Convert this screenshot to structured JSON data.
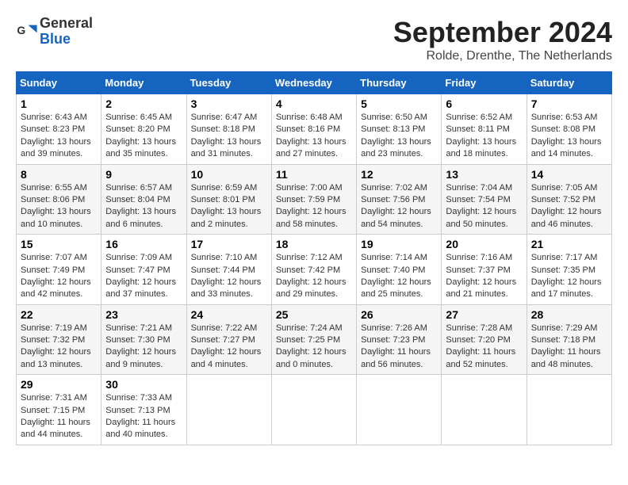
{
  "header": {
    "logo_line1": "General",
    "logo_line2": "Blue",
    "month": "September 2024",
    "location": "Rolde, Drenthe, The Netherlands"
  },
  "weekdays": [
    "Sunday",
    "Monday",
    "Tuesday",
    "Wednesday",
    "Thursday",
    "Friday",
    "Saturday"
  ],
  "weeks": [
    [
      {
        "day": "1",
        "info": "Sunrise: 6:43 AM\nSunset: 8:23 PM\nDaylight: 13 hours\nand 39 minutes."
      },
      {
        "day": "2",
        "info": "Sunrise: 6:45 AM\nSunset: 8:20 PM\nDaylight: 13 hours\nand 35 minutes."
      },
      {
        "day": "3",
        "info": "Sunrise: 6:47 AM\nSunset: 8:18 PM\nDaylight: 13 hours\nand 31 minutes."
      },
      {
        "day": "4",
        "info": "Sunrise: 6:48 AM\nSunset: 8:16 PM\nDaylight: 13 hours\nand 27 minutes."
      },
      {
        "day": "5",
        "info": "Sunrise: 6:50 AM\nSunset: 8:13 PM\nDaylight: 13 hours\nand 23 minutes."
      },
      {
        "day": "6",
        "info": "Sunrise: 6:52 AM\nSunset: 8:11 PM\nDaylight: 13 hours\nand 18 minutes."
      },
      {
        "day": "7",
        "info": "Sunrise: 6:53 AM\nSunset: 8:08 PM\nDaylight: 13 hours\nand 14 minutes."
      }
    ],
    [
      {
        "day": "8",
        "info": "Sunrise: 6:55 AM\nSunset: 8:06 PM\nDaylight: 13 hours\nand 10 minutes."
      },
      {
        "day": "9",
        "info": "Sunrise: 6:57 AM\nSunset: 8:04 PM\nDaylight: 13 hours\nand 6 minutes."
      },
      {
        "day": "10",
        "info": "Sunrise: 6:59 AM\nSunset: 8:01 PM\nDaylight: 13 hours\nand 2 minutes."
      },
      {
        "day": "11",
        "info": "Sunrise: 7:00 AM\nSunset: 7:59 PM\nDaylight: 12 hours\nand 58 minutes."
      },
      {
        "day": "12",
        "info": "Sunrise: 7:02 AM\nSunset: 7:56 PM\nDaylight: 12 hours\nand 54 minutes."
      },
      {
        "day": "13",
        "info": "Sunrise: 7:04 AM\nSunset: 7:54 PM\nDaylight: 12 hours\nand 50 minutes."
      },
      {
        "day": "14",
        "info": "Sunrise: 7:05 AM\nSunset: 7:52 PM\nDaylight: 12 hours\nand 46 minutes."
      }
    ],
    [
      {
        "day": "15",
        "info": "Sunrise: 7:07 AM\nSunset: 7:49 PM\nDaylight: 12 hours\nand 42 minutes."
      },
      {
        "day": "16",
        "info": "Sunrise: 7:09 AM\nSunset: 7:47 PM\nDaylight: 12 hours\nand 37 minutes."
      },
      {
        "day": "17",
        "info": "Sunrise: 7:10 AM\nSunset: 7:44 PM\nDaylight: 12 hours\nand 33 minutes."
      },
      {
        "day": "18",
        "info": "Sunrise: 7:12 AM\nSunset: 7:42 PM\nDaylight: 12 hours\nand 29 minutes."
      },
      {
        "day": "19",
        "info": "Sunrise: 7:14 AM\nSunset: 7:40 PM\nDaylight: 12 hours\nand 25 minutes."
      },
      {
        "day": "20",
        "info": "Sunrise: 7:16 AM\nSunset: 7:37 PM\nDaylight: 12 hours\nand 21 minutes."
      },
      {
        "day": "21",
        "info": "Sunrise: 7:17 AM\nSunset: 7:35 PM\nDaylight: 12 hours\nand 17 minutes."
      }
    ],
    [
      {
        "day": "22",
        "info": "Sunrise: 7:19 AM\nSunset: 7:32 PM\nDaylight: 12 hours\nand 13 minutes."
      },
      {
        "day": "23",
        "info": "Sunrise: 7:21 AM\nSunset: 7:30 PM\nDaylight: 12 hours\nand 9 minutes."
      },
      {
        "day": "24",
        "info": "Sunrise: 7:22 AM\nSunset: 7:27 PM\nDaylight: 12 hours\nand 4 minutes."
      },
      {
        "day": "25",
        "info": "Sunrise: 7:24 AM\nSunset: 7:25 PM\nDaylight: 12 hours\nand 0 minutes."
      },
      {
        "day": "26",
        "info": "Sunrise: 7:26 AM\nSunset: 7:23 PM\nDaylight: 11 hours\nand 56 minutes."
      },
      {
        "day": "27",
        "info": "Sunrise: 7:28 AM\nSunset: 7:20 PM\nDaylight: 11 hours\nand 52 minutes."
      },
      {
        "day": "28",
        "info": "Sunrise: 7:29 AM\nSunset: 7:18 PM\nDaylight: 11 hours\nand 48 minutes."
      }
    ],
    [
      {
        "day": "29",
        "info": "Sunrise: 7:31 AM\nSunset: 7:15 PM\nDaylight: 11 hours\nand 44 minutes."
      },
      {
        "day": "30",
        "info": "Sunrise: 7:33 AM\nSunset: 7:13 PM\nDaylight: 11 hours\nand 40 minutes."
      },
      {
        "day": "",
        "info": ""
      },
      {
        "day": "",
        "info": ""
      },
      {
        "day": "",
        "info": ""
      },
      {
        "day": "",
        "info": ""
      },
      {
        "day": "",
        "info": ""
      }
    ]
  ]
}
